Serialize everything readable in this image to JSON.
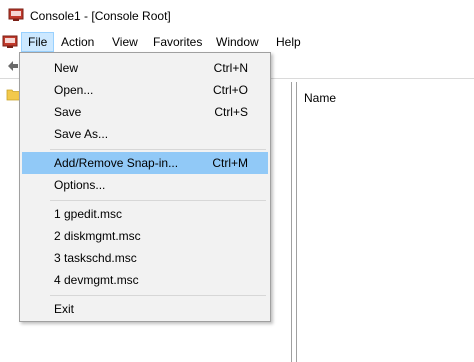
{
  "window": {
    "title": "Console1 - [Console Root]"
  },
  "menubar": {
    "items": [
      "File",
      "Action",
      "View",
      "Favorites",
      "Window",
      "Help"
    ]
  },
  "right_pane": {
    "column_header": "Name"
  },
  "file_menu": {
    "group1": [
      {
        "label": "New",
        "shortcut": "Ctrl+N"
      },
      {
        "label": "Open...",
        "shortcut": "Ctrl+O"
      },
      {
        "label": "Save",
        "shortcut": "Ctrl+S"
      },
      {
        "label": "Save As...",
        "shortcut": ""
      }
    ],
    "group2": [
      {
        "label": "Add/Remove Snap-in...",
        "shortcut": "Ctrl+M"
      },
      {
        "label": "Options...",
        "shortcut": ""
      }
    ],
    "recent": [
      {
        "label": "1 gpedit.msc"
      },
      {
        "label": "2 diskmgmt.msc"
      },
      {
        "label": "3 taskschd.msc"
      },
      {
        "label": "4 devmgmt.msc"
      }
    ],
    "exit": {
      "label": "Exit"
    },
    "highlighted": "Add/Remove Snap-in..."
  },
  "colors": {
    "highlight": "#91c9f7",
    "menu_bg": "#f2f2f2",
    "active_menu": "#cce8ff"
  },
  "icons": [
    "mmc-console-icon",
    "back-arrow-icon",
    "folder-icon"
  ]
}
